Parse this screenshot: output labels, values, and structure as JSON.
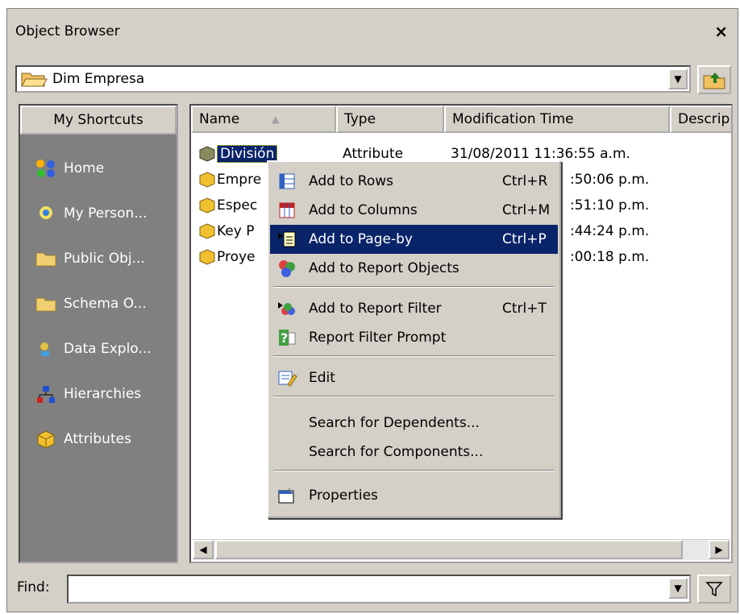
{
  "window": {
    "title": "Object Browser",
    "close": "×"
  },
  "location": {
    "value": "Dim Empresa"
  },
  "shortcuts": {
    "header": "My Shortcuts",
    "items": [
      {
        "label": "Home",
        "icon": "home-icon"
      },
      {
        "label": "My Person...",
        "icon": "my-personal-objects-icon"
      },
      {
        "label": "Public Obj...",
        "icon": "folder-icon"
      },
      {
        "label": "Schema O...",
        "icon": "folder-icon"
      },
      {
        "label": "Data Explo...",
        "icon": "data-explorer-icon"
      },
      {
        "label": "Hierarchies",
        "icon": "hierarchy-icon"
      },
      {
        "label": "Attributes",
        "icon": "attribute-cube-icon"
      }
    ]
  },
  "list": {
    "columns": [
      "Name",
      "Type",
      "Modification Time",
      "Descrip"
    ],
    "rows": [
      {
        "name": "División",
        "type": "Attribute",
        "time": "31/08/2011 11:36:55 a.m."
      },
      {
        "name": "Empre",
        "type": "",
        "time": ":50:06 p.m."
      },
      {
        "name": "Espec",
        "type": "",
        "time": ":51:10 p.m."
      },
      {
        "name": "Key P",
        "type": "",
        "time": ":44:24 p.m."
      },
      {
        "name": "Proye",
        "type": "",
        "time": ":00:18 p.m."
      }
    ]
  },
  "find": {
    "label": "Find:",
    "value": ""
  },
  "context_menu": {
    "items": [
      {
        "label": "Add to Rows",
        "shortcut": "Ctrl+R"
      },
      {
        "label": "Add to Columns",
        "shortcut": "Ctrl+M"
      },
      {
        "label": "Add to Page-by",
        "shortcut": "Ctrl+P",
        "selected": true
      },
      {
        "label": "Add to Report Objects",
        "shortcut": ""
      },
      {
        "label": "Add to Report Filter",
        "shortcut": "Ctrl+T"
      },
      {
        "label": "Report Filter Prompt",
        "shortcut": ""
      },
      {
        "label": "Edit",
        "shortcut": ""
      },
      {
        "label": "Search for Dependents...",
        "shortcut": ""
      },
      {
        "label": "Search for Components...",
        "shortcut": ""
      },
      {
        "label": "Properties",
        "shortcut": ""
      }
    ]
  },
  "colors": {
    "selection": "#0a246a",
    "panel": "#d4d0c8",
    "shortcut_bg": "#808080"
  }
}
